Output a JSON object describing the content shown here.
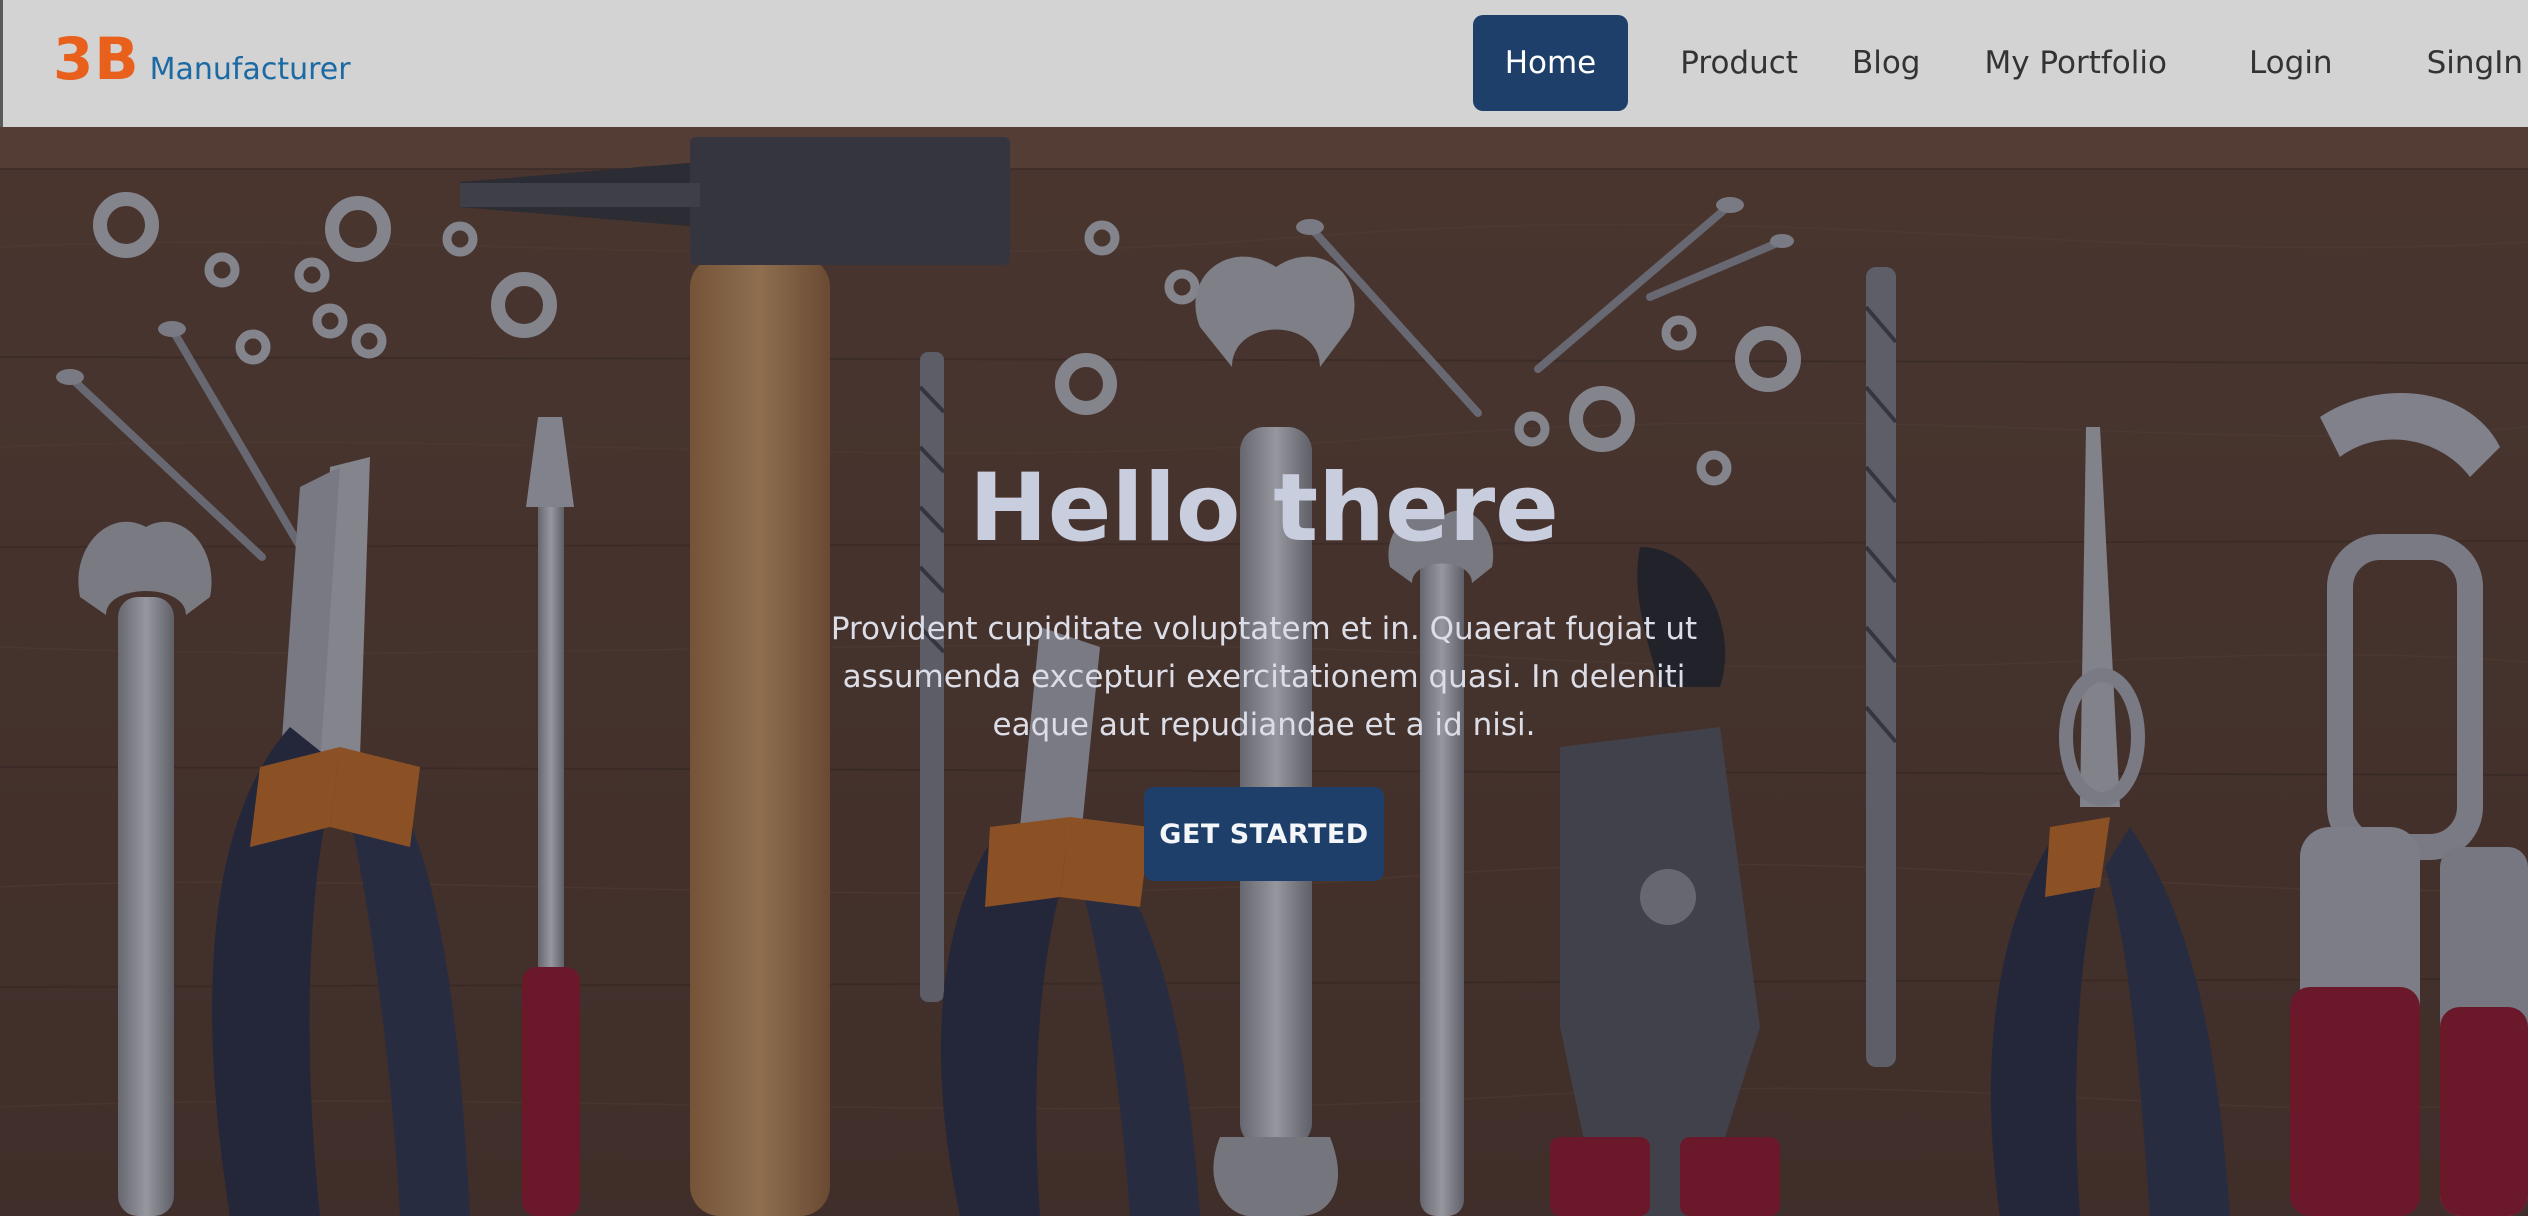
{
  "brand": {
    "mark": "3B",
    "name": "Manufacturer"
  },
  "nav": {
    "items": [
      {
        "label": "Home",
        "active": true
      },
      {
        "label": "Product",
        "active": false
      },
      {
        "label": "Blog",
        "active": false
      },
      {
        "label": "My Portfolio",
        "active": false
      },
      {
        "label": "Login",
        "active": false
      },
      {
        "label": "SingIn",
        "active": false
      }
    ]
  },
  "hero": {
    "title": "Hello there",
    "text": "Provident cupiditate voluptatem et in. Quaerat fugiat ut assumenda excepturi exercitationem quasi. In deleniti eaque aut repudiandae et a id nisi.",
    "button_label": "GET STARTED",
    "background_image": "workshop-tools-on-wooden-board"
  },
  "colors": {
    "brand_mark": "#e8601c",
    "brand_name": "#1c6aa3",
    "accent": "#1d3f69",
    "navbar_bg": "#d3d3d3"
  }
}
